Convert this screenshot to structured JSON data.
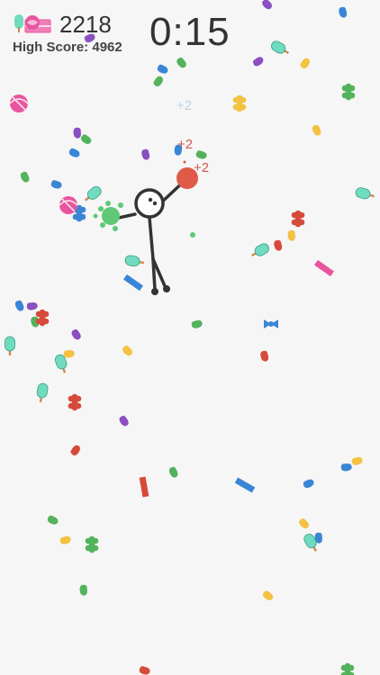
{
  "hud": {
    "score": "2218",
    "high_score_label": "High Score:",
    "high_score_value": "4962",
    "timer": "0:15"
  },
  "floating_points": [
    {
      "text": "+2",
      "color": "#bcd3ea"
    },
    {
      "text": "+2",
      "color": "#d05a4a"
    },
    {
      "text": "+2",
      "color": "#d05a4a"
    }
  ],
  "colors": {
    "background": "#f6f6f6",
    "stickman": "#333333",
    "held_ball": "#e05a48",
    "splat": "#5fc877"
  },
  "candy_palette": {
    "blue": "#3a86d6",
    "purple": "#8a4fc0",
    "green": "#52b35c",
    "yellow": "#f3c242",
    "red": "#d64a3c",
    "pink": "#e8559e",
    "mint": "#6fdcc0"
  }
}
